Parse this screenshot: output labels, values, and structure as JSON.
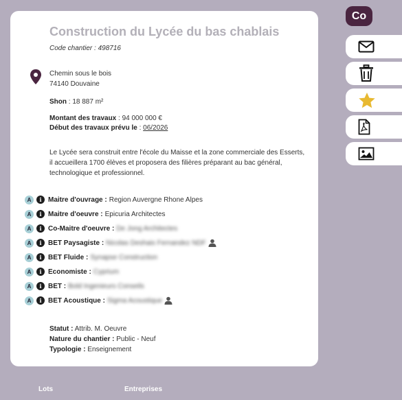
{
  "project": {
    "title": "Construction du Lycée du bas chablais",
    "code": "Code chantier : 498716",
    "address_line1": "Chemin sous le bois",
    "address_line2": "74140 Douvaine",
    "shon_label": "Shon",
    "shon_value": " : 18 887 m²",
    "amount_label": "Montant des travaux",
    "amount_value": " : 94 000 000 €",
    "start_label": "Début des travaux prévu le",
    "start_sep": " : ",
    "start_value": "06/2026",
    "description": "Le Lycée sera construit entre l'école du Maisse et la zone commerciale des Esserts, il accueillera 1700 élèves et proposera des filières préparant au bac général, technologique et professionnel."
  },
  "actors": [
    {
      "role": "Maitre d'ouvrage :",
      "value": "Region Auvergne Rhone Alpes",
      "blurred": false
    },
    {
      "role": "Maitre d'oeuvre :",
      "value": "Epicuria Architectes",
      "blurred": false
    },
    {
      "role": "Co-Maitre d'oeuvre :",
      "value": "De Jong Architectes",
      "blurred": true
    },
    {
      "role": "BET Paysagiste :",
      "value": "Nicolas Deshais Fernandez NDF",
      "blurred": true
    },
    {
      "role": "BET Fluide :",
      "value": "Synapse Construction",
      "blurred": true
    },
    {
      "role": "Economiste :",
      "value": "Cyprium",
      "blurred": true
    },
    {
      "role": "BET :",
      "value": "Bold Ingenieurs Conseils",
      "blurred": true
    },
    {
      "role": "BET Acoustique :",
      "value": "Sigma Acoustique",
      "blurred": true
    }
  ],
  "badges": {
    "a": "A",
    "i": "i"
  },
  "status": {
    "statut_label": "Statut :",
    "statut_value": "Attrib. M. Oeuvre",
    "nature_label": "Nature du chantier :",
    "nature_value": "Public - Neuf",
    "typologie_label": "Typologie :",
    "typologie_value": "Enseignement"
  },
  "sidebar": {
    "co_label": "Co",
    "buttons": [
      "mail-icon",
      "trash-icon",
      "star-icon",
      "pdf-icon",
      "image-icon"
    ]
  },
  "bottom_tabs": [
    "Lots",
    "Entreprises"
  ],
  "colors": {
    "background": "#b4adbd",
    "accent": "#4a2540",
    "star": "#e8b931",
    "badge_a": "#a7cfd6"
  }
}
